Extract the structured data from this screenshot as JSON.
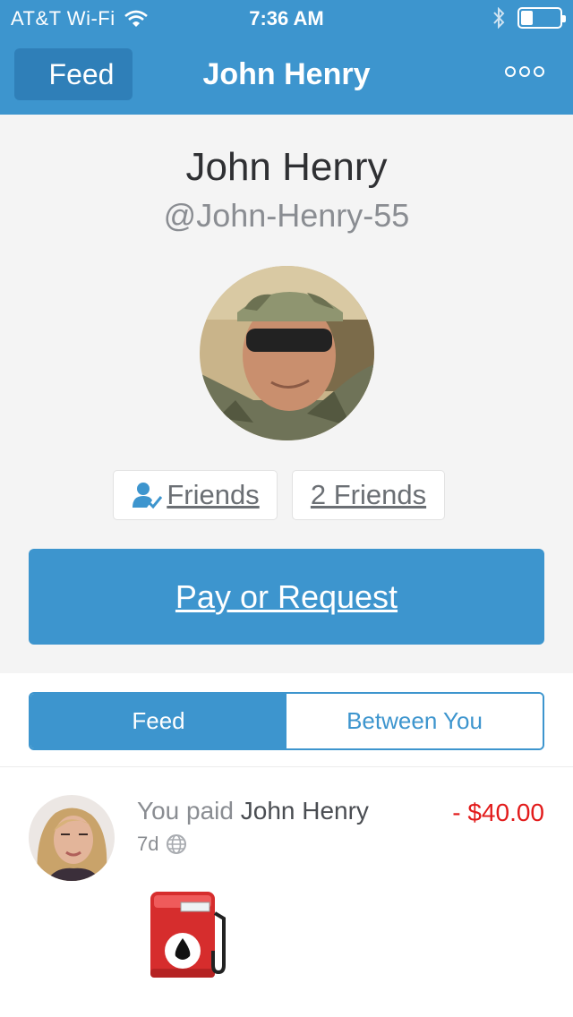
{
  "status_bar": {
    "carrier": "AT&T Wi-Fi",
    "time": "7:36 AM",
    "battery_level": 0.3,
    "icons": [
      "wifi-icon",
      "bluetooth-icon",
      "battery-icon"
    ]
  },
  "nav": {
    "back_label": "Feed",
    "title": "John Henry",
    "more_icon": "more-icon"
  },
  "profile": {
    "name": "John Henry",
    "handle": "@John-Henry-55",
    "friend_status_label": "Friends",
    "friend_count_label": "2 Friends",
    "pay_button_label": "Pay or Request"
  },
  "tabs": [
    {
      "label": "Feed",
      "active": true
    },
    {
      "label": "Between You",
      "active": false
    }
  ],
  "feed": [
    {
      "prefix": "You paid ",
      "target": "John Henry",
      "amount": "- $40.00",
      "time": "7d",
      "privacy_icon": "globe-icon",
      "note_icon": "fuel-pump-icon"
    }
  ],
  "colors": {
    "brand": "#3d95ce",
    "negative_amount": "#e21b1b",
    "background": "#f4f4f4"
  }
}
